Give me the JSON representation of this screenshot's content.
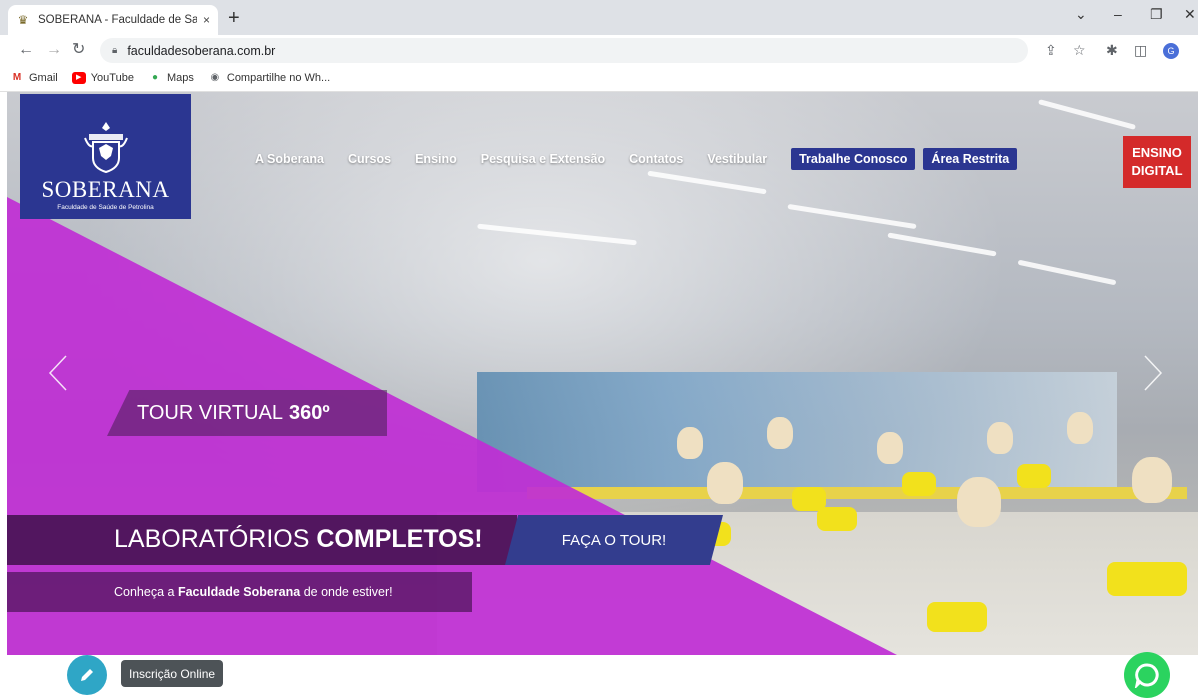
{
  "browser": {
    "tab_title": "SOBERANA - Faculdade de Saúd",
    "tab_close": "×",
    "new_tab": "+",
    "url": "faculdadesoberana.com.br",
    "window_controls": {
      "dropdown": "⌄",
      "minimize": "–",
      "restore": "❐",
      "close": "✕"
    },
    "profile_initial": "G"
  },
  "bookmarks": [
    {
      "label": "Gmail",
      "icon": "gmail-icon",
      "color": "#d93025"
    },
    {
      "label": "YouTube",
      "icon": "youtube-icon",
      "color": "#ff0000"
    },
    {
      "label": "Maps",
      "icon": "maps-pin-icon",
      "color": "#34a853"
    },
    {
      "label": "Compartilhe no Wh...",
      "icon": "globe-icon",
      "color": "#5f6368"
    }
  ],
  "site": {
    "logo": {
      "name": "SOBERANA",
      "subtitle": "Faculdade de Saúde de Petrolina",
      "bg_color": "#2b3691"
    },
    "nav": {
      "links": [
        "A Soberana",
        "Cursos",
        "Ensino",
        "Pesquisa e Extensão",
        "Contatos",
        "Vestibular"
      ],
      "pill_1": "Trabalhe Conosco",
      "pill_2": "Área Restrita"
    },
    "badge": {
      "line1": "ENSINO",
      "line2": "DIGITAL",
      "color": "#d42a2a"
    },
    "hero": {
      "tour_label_light": "TOUR VIRTUAL",
      "tour_label_bold": "360º",
      "title_light": "LABORATÓRIOS",
      "title_bold": "COMPLETOS!",
      "cta": "FAÇA O TOUR!",
      "subtitle_prefix": "Conheça a",
      "subtitle_bold": "Faculdade Soberana",
      "subtitle_suffix": "de onde estiver!",
      "accent_color": "#c02ed4"
    },
    "inscricao_label": "Inscrição Online",
    "pen_color": "#2fa6c6",
    "chat_color": "#2bd35f"
  }
}
